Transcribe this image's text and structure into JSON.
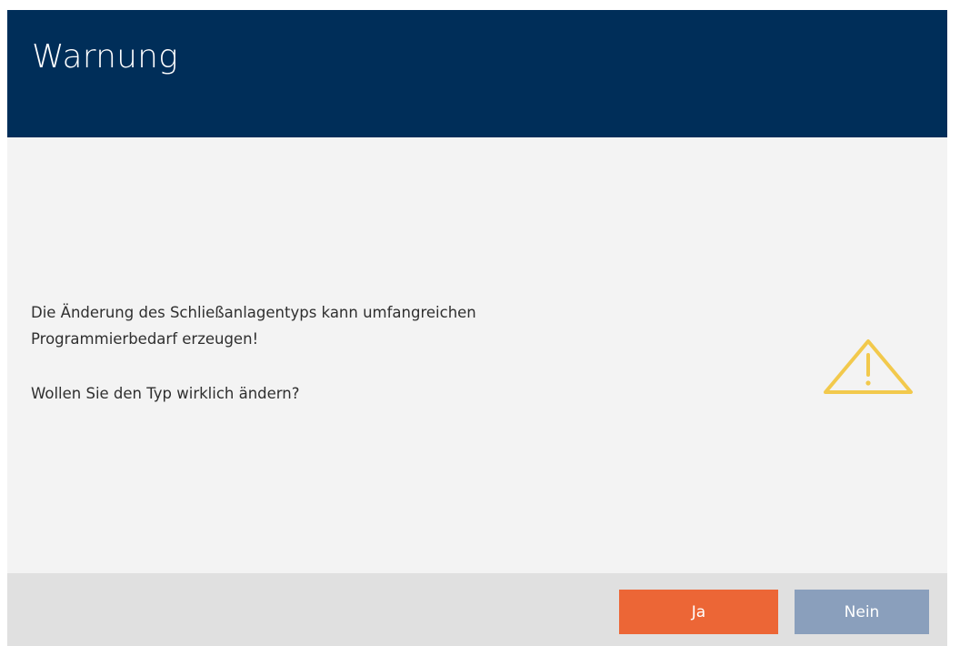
{
  "dialog": {
    "title": "Warnung",
    "message_line1": "Die Änderung des Schließanlagentyps kann umfangreichen",
    "message_line2": "Programmierbedarf erzeugen!",
    "question": "Wollen Sie den Typ wirklich ändern?",
    "icon": "warning-triangle-icon",
    "buttons": {
      "yes_label": "Ja",
      "no_label": "Nein"
    }
  },
  "colors": {
    "header_bg": "#002e59",
    "body_bg": "#f3f3f3",
    "footer_bg": "#e0e0e0",
    "yes_button": "#ec6636",
    "no_button": "#8a9fbc",
    "warning_icon": "#f2c94c"
  }
}
